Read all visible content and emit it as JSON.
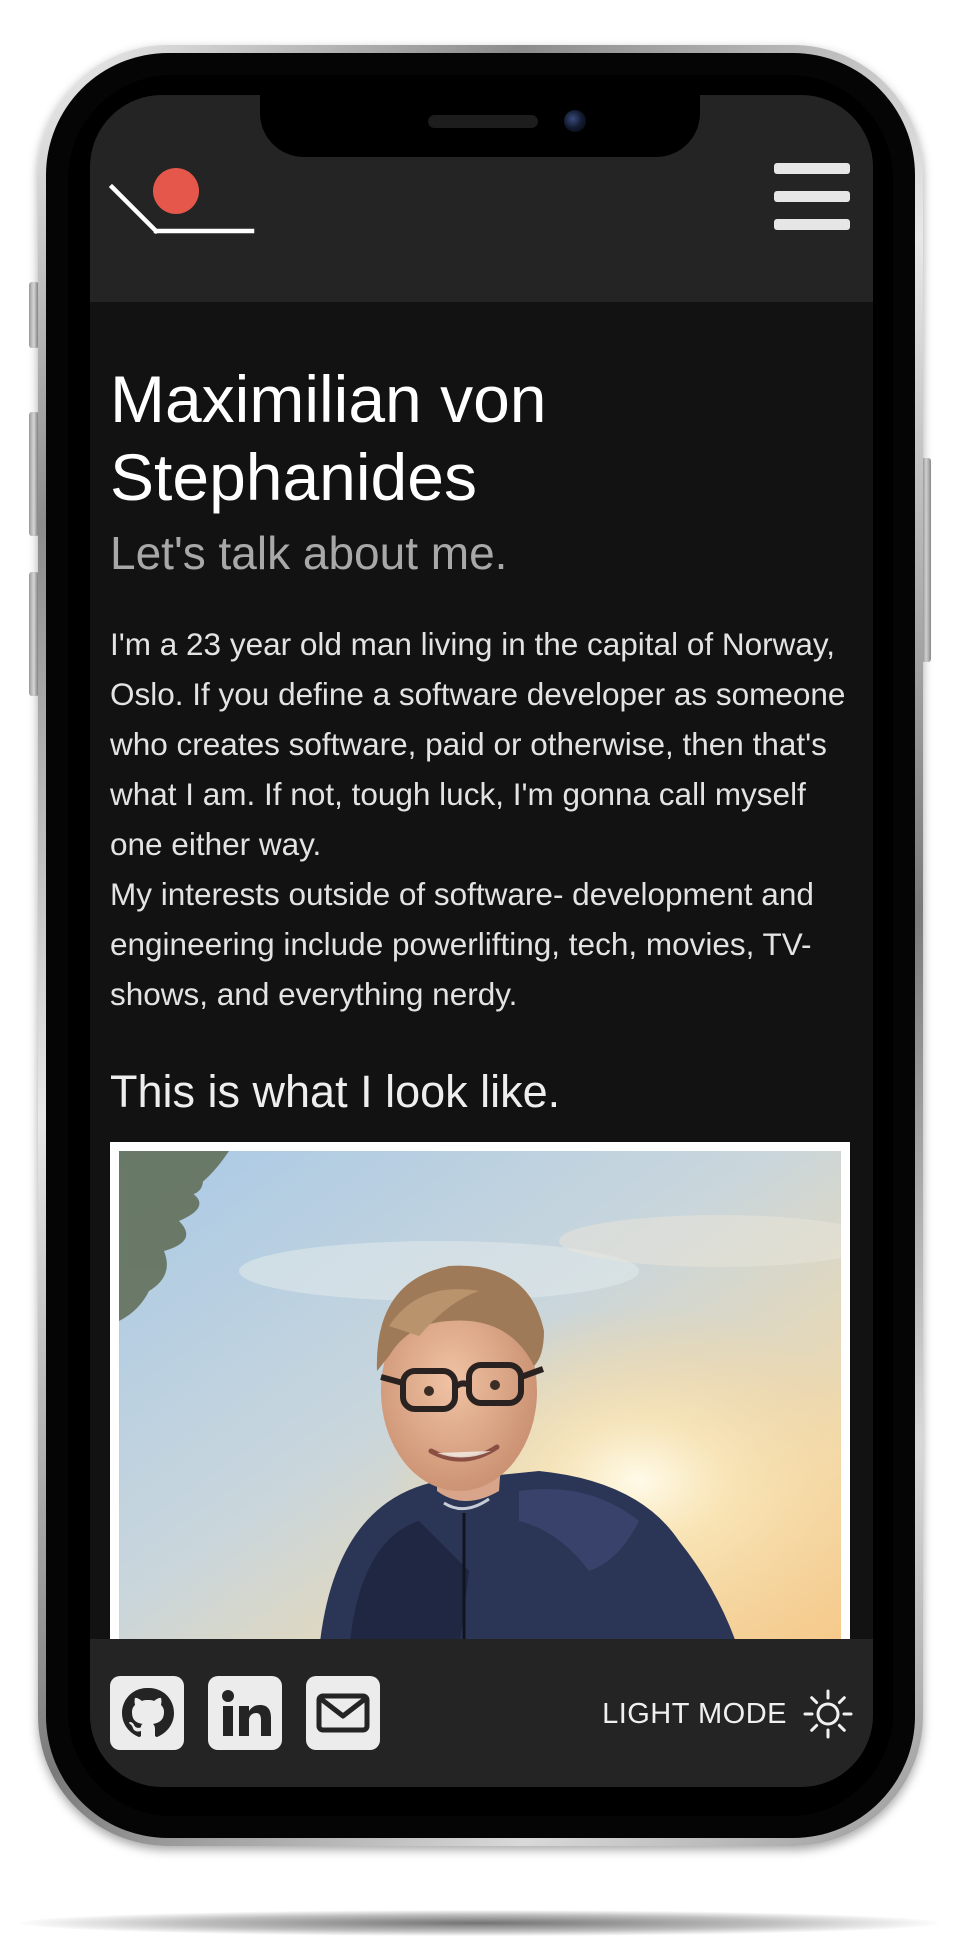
{
  "header": {
    "logo": "logo",
    "menu_icon": "hamburger-menu-icon"
  },
  "about": {
    "name": "Maximilian von Stephanides",
    "subtitle": "Let's talk about me.",
    "paragraphs": [
      "I'm a 23 year old man living in the capital of Norway, Oslo. If you define a software developer as someone who creates software, paid or otherwise, then that's what I am. If not, tough luck, I'm gonna call myself one either way.",
      "My interests outside of software- development and engineering include powerlifting, tech, movies, TV-shows, and everything nerdy."
    ],
    "photo_heading": "This is what I look like."
  },
  "footer": {
    "links": [
      {
        "icon": "github-icon"
      },
      {
        "icon": "linkedin-icon"
      },
      {
        "icon": "mail-icon"
      }
    ],
    "theme_toggle": {
      "label": "LIGHT MODE",
      "icon": "sun-icon"
    }
  },
  "colors": {
    "background": "#121212",
    "header_footer": "#242424",
    "accent_red": "#e4574a",
    "text_primary": "#ffffff",
    "text_muted": "#a8a8a8"
  }
}
